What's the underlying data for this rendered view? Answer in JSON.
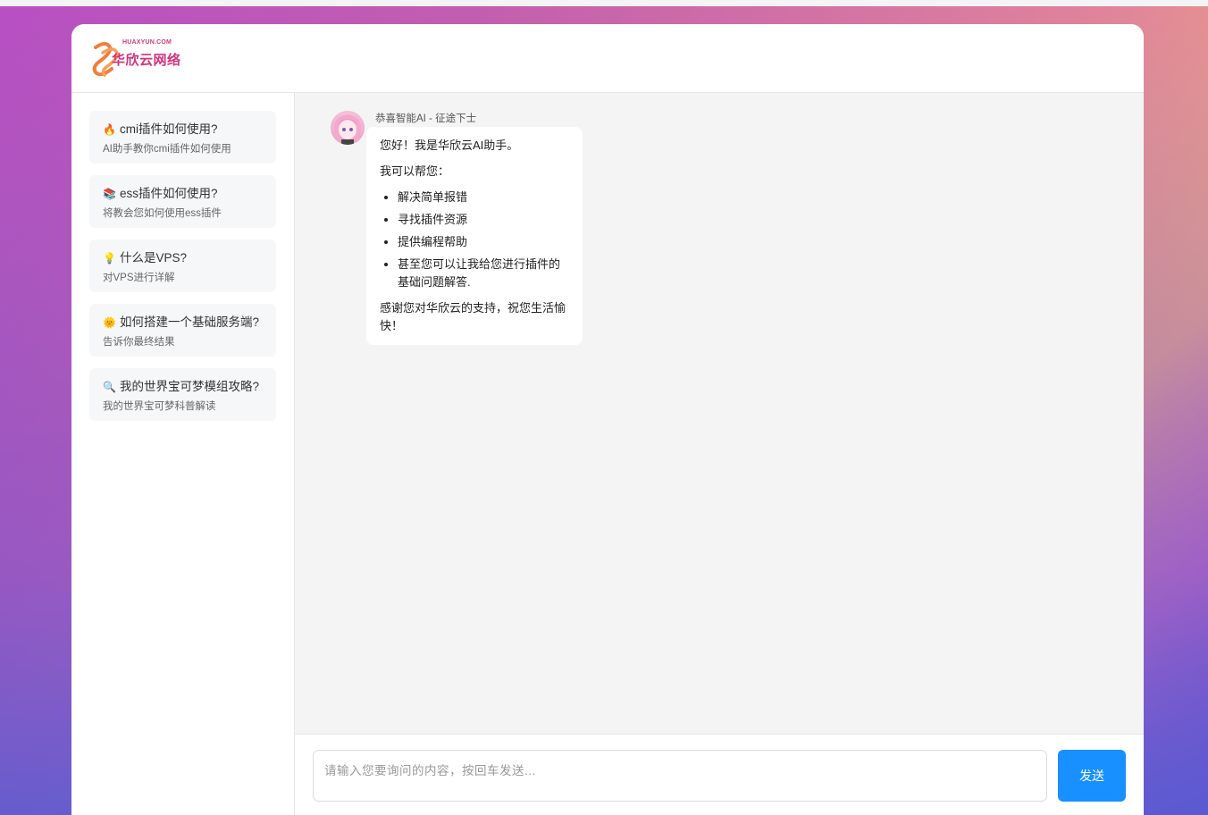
{
  "brand": {
    "small_text": "HUAXYUN.COM",
    "name": "华欣云网络"
  },
  "sidebar": {
    "items": [
      {
        "icon": "fire-icon",
        "emoji": "🔥",
        "title": "cmi插件如何使用?",
        "subtitle": "AI助手教你cmi插件如何使用"
      },
      {
        "icon": "books-icon",
        "emoji": "📚",
        "title": "ess插件如何使用?",
        "subtitle": "将教会您如何使用ess插件"
      },
      {
        "icon": "lightbulb-icon",
        "emoji": "💡",
        "title": "什么是VPS?",
        "subtitle": "对VPS进行详解"
      },
      {
        "icon": "sun-icon",
        "emoji": "🌞",
        "title": "如何搭建一个基础服务端?",
        "subtitle": "告诉你最终结果"
      },
      {
        "icon": "magnifier-icon",
        "emoji": "🔍",
        "title": "我的世界宝可梦模组攻略?",
        "subtitle": "我的世界宝可梦科普解读"
      }
    ]
  },
  "chat": {
    "sender": "恭喜智能AI - 征途下士",
    "greeting": "您好！我是华欣云AI助手。",
    "intro": "我可以帮您：",
    "list": [
      "解决简单报错",
      "寻找插件资源",
      "提供编程帮助",
      "甚至您可以让我给您进行插件的基础问题解答."
    ],
    "closing": "感谢您对华欣云的支持，祝您生活愉快！"
  },
  "composer": {
    "placeholder": "请输入您要询问的内容，按回车发送...",
    "send_label": "发送"
  },
  "colors": {
    "accent": "#1890ff",
    "brand": "#d2337c"
  }
}
